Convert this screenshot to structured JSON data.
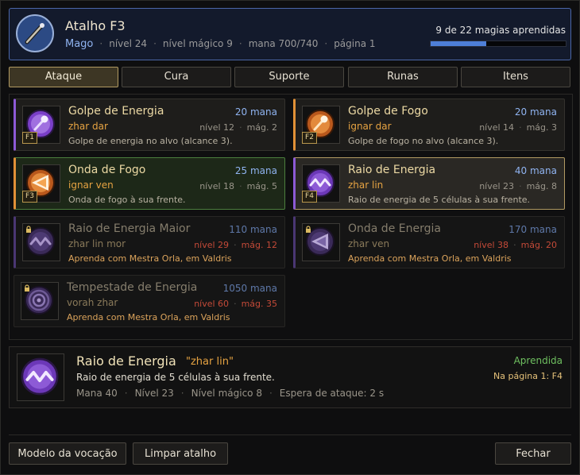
{
  "header": {
    "title": "Atalho F3",
    "vocation": "Mago",
    "level": "nível 24",
    "magic_level": "nível mágico 9",
    "mana": "mana 700/740",
    "page": "página 1",
    "progress_label": "9 de 22 magias aprendidas",
    "progress_fraction": 0.41,
    "icon": "magic-wand-icon"
  },
  "tabs": [
    {
      "label": "Ataque",
      "active": true
    },
    {
      "label": "Cura",
      "active": false
    },
    {
      "label": "Suporte",
      "active": false
    },
    {
      "label": "Runas",
      "active": false
    },
    {
      "label": "Itens",
      "active": false
    }
  ],
  "spells": [
    {
      "name": "Golpe de Energia",
      "mana": "20 mana",
      "words": "zhar dar",
      "level": "nível 12",
      "mlevel": "mág. 2",
      "desc": "Golpe de energia no alvo (alcance 3).",
      "hotkey": "F1",
      "icon": "energy-strike-icon",
      "state": "learned"
    },
    {
      "name": "Golpe de Fogo",
      "mana": "20 mana",
      "words": "ignar dar",
      "level": "nível 14",
      "mlevel": "mág. 3",
      "desc": "Golpe de fogo no alvo (alcance 3).",
      "hotkey": "F2",
      "icon": "fire-strike-icon",
      "state": "learned"
    },
    {
      "name": "Onda de Fogo",
      "mana": "25 mana",
      "words": "ignar ven",
      "level": "nível 18",
      "mlevel": "mág. 5",
      "desc": "Onda de fogo à sua frente.",
      "hotkey": "F3",
      "icon": "fire-wave-icon",
      "state": "current"
    },
    {
      "name": "Raio de Energia",
      "mana": "40 mana",
      "words": "zhar lin",
      "level": "nível 23",
      "mlevel": "mág. 8",
      "desc": "Raio de energia de 5 células à sua frente.",
      "hotkey": "F4",
      "icon": "energy-beam-icon",
      "state": "selected"
    },
    {
      "name": "Raio de Energia Maior",
      "mana": "110 mana",
      "words": "zhar lin mor",
      "level": "nível 29",
      "mlevel": "mág. 12",
      "desc": "Aprenda com Mestra Orla, em Valdris",
      "hotkey": "",
      "icon": "great-energy-beam-icon",
      "state": "locked"
    },
    {
      "name": "Onda de Energia",
      "mana": "170 mana",
      "words": "zhar ven",
      "level": "nível 38",
      "mlevel": "mág. 20",
      "desc": "Aprenda com Mestra Orla, em Valdris",
      "hotkey": "",
      "icon": "energy-wave-icon",
      "state": "locked"
    },
    {
      "name": "Tempestade de Energia",
      "mana": "1050 mana",
      "words": "vorah zhar",
      "level": "nível 60",
      "mlevel": "mág. 35",
      "desc": "Aprenda com Mestra Orla, em Valdris",
      "hotkey": "",
      "icon": "energy-storm-icon",
      "state": "locked"
    }
  ],
  "detail": {
    "name": "Raio de Energia",
    "words": "\"zhar lin\"",
    "desc": "Raio de energia de 5 células à sua frente.",
    "mana": "Mana 40",
    "level": "Nível 23",
    "magic_level": "Nível mágico 8",
    "cooldown": "Espera de ataque: 2 s",
    "status": "Aprendida",
    "page_info": "Na página 1: F4",
    "icon": "energy-beam-icon"
  },
  "buttons": {
    "vocation_template": "Modelo da vocação",
    "clear_hotkey": "Limpar atalho",
    "close": "Fechar"
  },
  "colors": {
    "accent_blue": "#4e7fd8",
    "energy_purple": "#8d5ad6",
    "fire_orange": "#e19137",
    "gold_border": "#b19a62",
    "learned_green": "#6fc060",
    "locked_red": "#c44a38"
  }
}
